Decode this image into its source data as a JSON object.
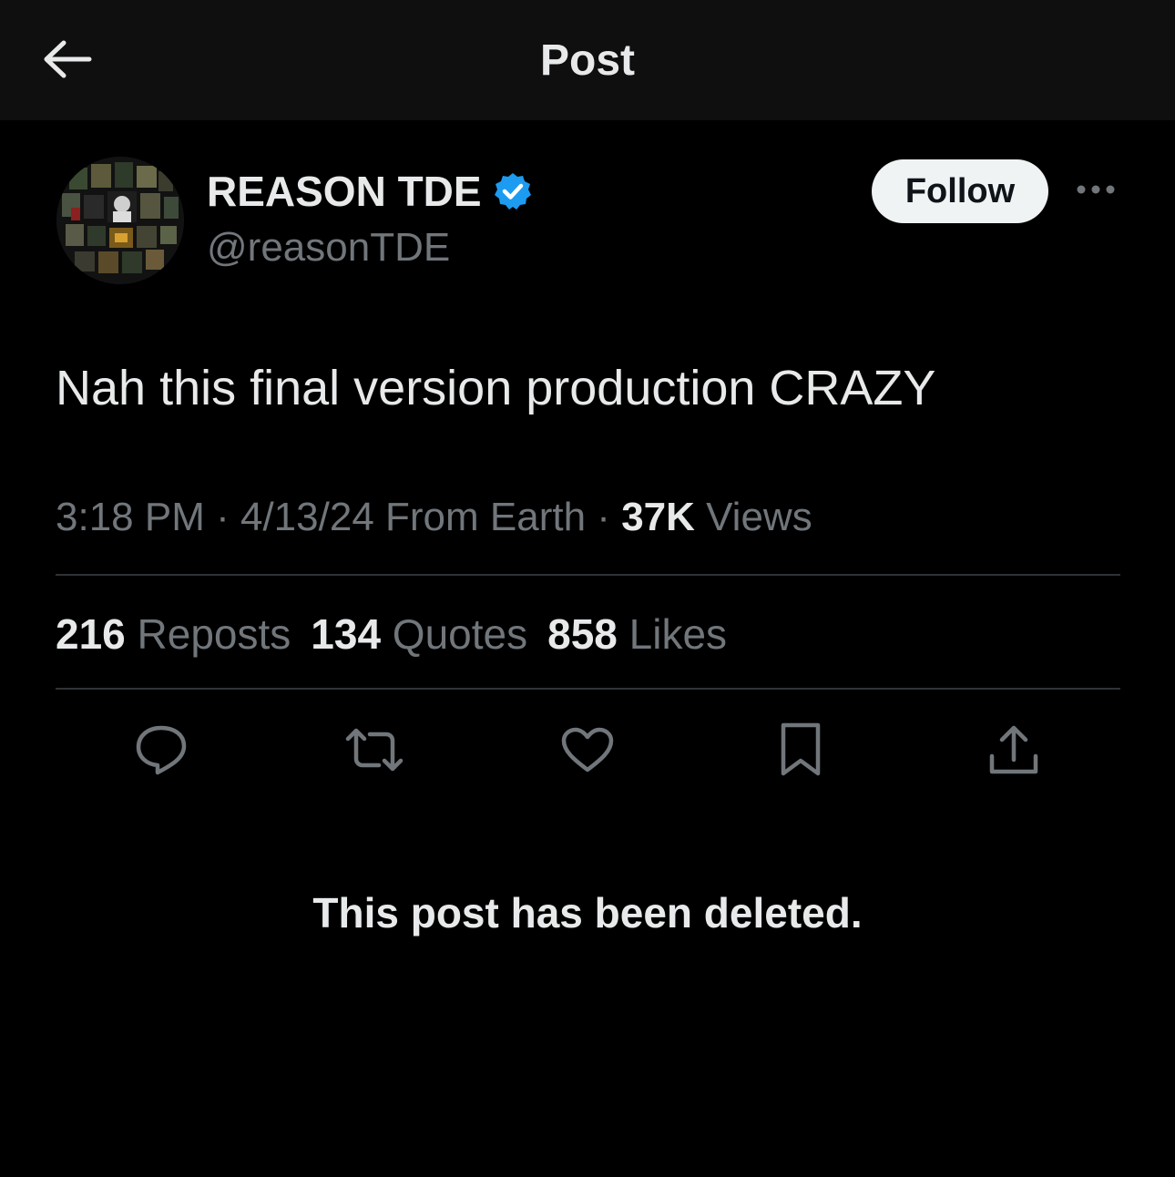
{
  "header": {
    "title": "Post",
    "back_icon": "arrow-left-icon"
  },
  "author": {
    "display_name": "REASON TDE",
    "handle": "@reasonTDE",
    "verified_color": "#1d9bf0",
    "avatar_icon": "avatar-collage"
  },
  "follow_label": "Follow",
  "more_icon": "ellipsis-icon",
  "post": {
    "text": "Nah this final version production CRAZY"
  },
  "meta": {
    "time": "3:18 PM",
    "sep1": " · ",
    "date": "4/13/24",
    "source": " From Earth",
    "sep2": " · ",
    "views_count": "37K",
    "views_label": " Views"
  },
  "stats": {
    "reposts_count": "216",
    "reposts_label": " Reposts",
    "quotes_count": "134",
    "quotes_label": " Quotes",
    "likes_count": "858",
    "likes_label": " Likes"
  },
  "actions": [
    "reply-icon",
    "repost-icon",
    "like-icon",
    "bookmark-icon",
    "share-icon"
  ],
  "deleted_notice": "This post has been deleted."
}
